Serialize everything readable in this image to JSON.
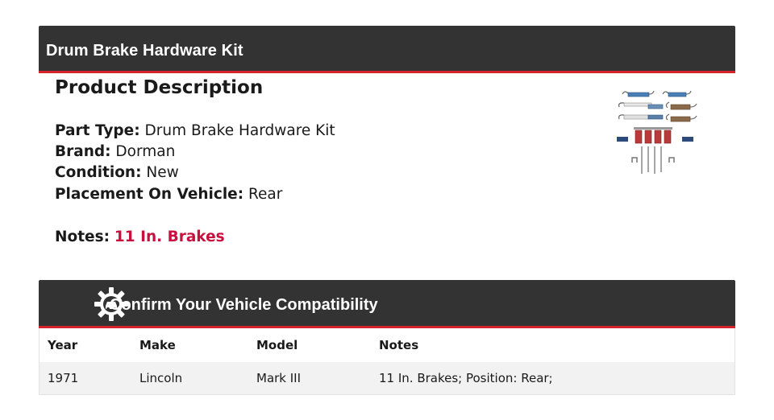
{
  "header": {
    "title": "Drum Brake Hardware Kit"
  },
  "description": {
    "heading": "Product Description",
    "specs": [
      {
        "label": "Part Type:",
        "value": "Drum Brake Hardware Kit"
      },
      {
        "label": "Brand:",
        "value": "Dorman"
      },
      {
        "label": "Condition:",
        "value": "New"
      },
      {
        "label": "Placement On Vehicle:",
        "value": "Rear"
      }
    ],
    "notes": {
      "label": "Notes:",
      "value": "11 In. Brakes"
    }
  },
  "compatibility": {
    "title": "Confirm Your Vehicle Compatibility",
    "icon": "gear-car-icon",
    "columns": [
      "Year",
      "Make",
      "Model",
      "Notes"
    ],
    "rows": [
      {
        "year": "1971",
        "make": "Lincoln",
        "model": "Mark III",
        "notes": "11 In. Brakes; Position: Rear;"
      }
    ]
  },
  "colors": {
    "banner": "#333333",
    "accent": "#d6222b",
    "notes": "#c8103e"
  }
}
